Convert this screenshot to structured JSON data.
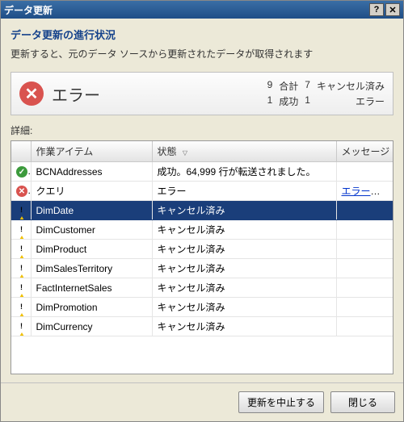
{
  "window": {
    "title": "データ更新"
  },
  "header": {
    "heading": "データ更新の進行状況",
    "subtext": "更新すると、元のデータ ソースから更新されたデータが取得されます"
  },
  "status": {
    "title": "エラー",
    "counts": {
      "total_n": "9",
      "total_label": "合計",
      "cancel_n": "7",
      "cancel_label": "キャンセル済み",
      "succ_n": "1",
      "succ_label": "成功",
      "err_n": "1",
      "err_label": "エラー"
    }
  },
  "details_label": "詳細:",
  "columns": {
    "item": "作業アイテム",
    "status": "状態",
    "message": "メッセージ"
  },
  "rows": [
    {
      "icon": "ok",
      "item": "BCNAddresses",
      "status": "成功。64,999 行が転送されました。",
      "msg": "",
      "selected": false
    },
    {
      "icon": "err",
      "item": "クエリ",
      "status": "エラー",
      "msg": "エラーの詳細",
      "msgIsLink": true,
      "selected": false
    },
    {
      "icon": "warn",
      "item": "DimDate",
      "status": "キャンセル済み",
      "msg": "",
      "selected": true
    },
    {
      "icon": "warn",
      "item": "DimCustomer",
      "status": "キャンセル済み",
      "msg": "",
      "selected": false
    },
    {
      "icon": "warn",
      "item": "DimProduct",
      "status": "キャンセル済み",
      "msg": "",
      "selected": false
    },
    {
      "icon": "warn",
      "item": "DimSalesTerritory",
      "status": "キャンセル済み",
      "msg": "",
      "selected": false
    },
    {
      "icon": "warn",
      "item": "FactInternetSales",
      "status": "キャンセル済み",
      "msg": "",
      "selected": false
    },
    {
      "icon": "warn",
      "item": "DimPromotion",
      "status": "キャンセル済み",
      "msg": "",
      "selected": false
    },
    {
      "icon": "warn",
      "item": "DimCurrency",
      "status": "キャンセル済み",
      "msg": "",
      "selected": false
    }
  ],
  "buttons": {
    "stop": "更新を中止する",
    "close": "閉じる"
  }
}
